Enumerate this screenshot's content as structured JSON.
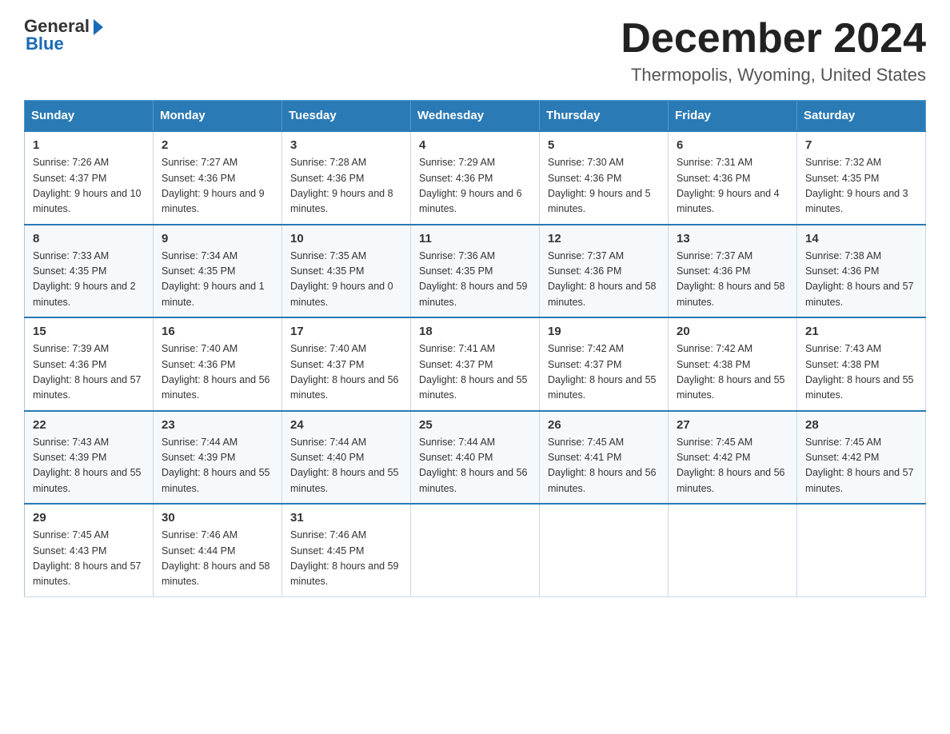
{
  "logo": {
    "part1": "General",
    "part2": "Blue"
  },
  "title": "December 2024",
  "subtitle": "Thermopolis, Wyoming, United States",
  "days_of_week": [
    "Sunday",
    "Monday",
    "Tuesday",
    "Wednesday",
    "Thursday",
    "Friday",
    "Saturday"
  ],
  "weeks": [
    [
      {
        "day": "1",
        "sunrise": "7:26 AM",
        "sunset": "4:37 PM",
        "daylight": "9 hours and 10 minutes."
      },
      {
        "day": "2",
        "sunrise": "7:27 AM",
        "sunset": "4:36 PM",
        "daylight": "9 hours and 9 minutes."
      },
      {
        "day": "3",
        "sunrise": "7:28 AM",
        "sunset": "4:36 PM",
        "daylight": "9 hours and 8 minutes."
      },
      {
        "day": "4",
        "sunrise": "7:29 AM",
        "sunset": "4:36 PM",
        "daylight": "9 hours and 6 minutes."
      },
      {
        "day": "5",
        "sunrise": "7:30 AM",
        "sunset": "4:36 PM",
        "daylight": "9 hours and 5 minutes."
      },
      {
        "day": "6",
        "sunrise": "7:31 AM",
        "sunset": "4:36 PM",
        "daylight": "9 hours and 4 minutes."
      },
      {
        "day": "7",
        "sunrise": "7:32 AM",
        "sunset": "4:35 PM",
        "daylight": "9 hours and 3 minutes."
      }
    ],
    [
      {
        "day": "8",
        "sunrise": "7:33 AM",
        "sunset": "4:35 PM",
        "daylight": "9 hours and 2 minutes."
      },
      {
        "day": "9",
        "sunrise": "7:34 AM",
        "sunset": "4:35 PM",
        "daylight": "9 hours and 1 minute."
      },
      {
        "day": "10",
        "sunrise": "7:35 AM",
        "sunset": "4:35 PM",
        "daylight": "9 hours and 0 minutes."
      },
      {
        "day": "11",
        "sunrise": "7:36 AM",
        "sunset": "4:35 PM",
        "daylight": "8 hours and 59 minutes."
      },
      {
        "day": "12",
        "sunrise": "7:37 AM",
        "sunset": "4:36 PM",
        "daylight": "8 hours and 58 minutes."
      },
      {
        "day": "13",
        "sunrise": "7:37 AM",
        "sunset": "4:36 PM",
        "daylight": "8 hours and 58 minutes."
      },
      {
        "day": "14",
        "sunrise": "7:38 AM",
        "sunset": "4:36 PM",
        "daylight": "8 hours and 57 minutes."
      }
    ],
    [
      {
        "day": "15",
        "sunrise": "7:39 AM",
        "sunset": "4:36 PM",
        "daylight": "8 hours and 57 minutes."
      },
      {
        "day": "16",
        "sunrise": "7:40 AM",
        "sunset": "4:36 PM",
        "daylight": "8 hours and 56 minutes."
      },
      {
        "day": "17",
        "sunrise": "7:40 AM",
        "sunset": "4:37 PM",
        "daylight": "8 hours and 56 minutes."
      },
      {
        "day": "18",
        "sunrise": "7:41 AM",
        "sunset": "4:37 PM",
        "daylight": "8 hours and 55 minutes."
      },
      {
        "day": "19",
        "sunrise": "7:42 AM",
        "sunset": "4:37 PM",
        "daylight": "8 hours and 55 minutes."
      },
      {
        "day": "20",
        "sunrise": "7:42 AM",
        "sunset": "4:38 PM",
        "daylight": "8 hours and 55 minutes."
      },
      {
        "day": "21",
        "sunrise": "7:43 AM",
        "sunset": "4:38 PM",
        "daylight": "8 hours and 55 minutes."
      }
    ],
    [
      {
        "day": "22",
        "sunrise": "7:43 AM",
        "sunset": "4:39 PM",
        "daylight": "8 hours and 55 minutes."
      },
      {
        "day": "23",
        "sunrise": "7:44 AM",
        "sunset": "4:39 PM",
        "daylight": "8 hours and 55 minutes."
      },
      {
        "day": "24",
        "sunrise": "7:44 AM",
        "sunset": "4:40 PM",
        "daylight": "8 hours and 55 minutes."
      },
      {
        "day": "25",
        "sunrise": "7:44 AM",
        "sunset": "4:40 PM",
        "daylight": "8 hours and 56 minutes."
      },
      {
        "day": "26",
        "sunrise": "7:45 AM",
        "sunset": "4:41 PM",
        "daylight": "8 hours and 56 minutes."
      },
      {
        "day": "27",
        "sunrise": "7:45 AM",
        "sunset": "4:42 PM",
        "daylight": "8 hours and 56 minutes."
      },
      {
        "day": "28",
        "sunrise": "7:45 AM",
        "sunset": "4:42 PM",
        "daylight": "8 hours and 57 minutes."
      }
    ],
    [
      {
        "day": "29",
        "sunrise": "7:45 AM",
        "sunset": "4:43 PM",
        "daylight": "8 hours and 57 minutes."
      },
      {
        "day": "30",
        "sunrise": "7:46 AM",
        "sunset": "4:44 PM",
        "daylight": "8 hours and 58 minutes."
      },
      {
        "day": "31",
        "sunrise": "7:46 AM",
        "sunset": "4:45 PM",
        "daylight": "8 hours and 59 minutes."
      },
      null,
      null,
      null,
      null
    ]
  ],
  "labels": {
    "sunrise_prefix": "Sunrise: ",
    "sunset_prefix": "Sunset: ",
    "daylight_prefix": "Daylight: "
  }
}
